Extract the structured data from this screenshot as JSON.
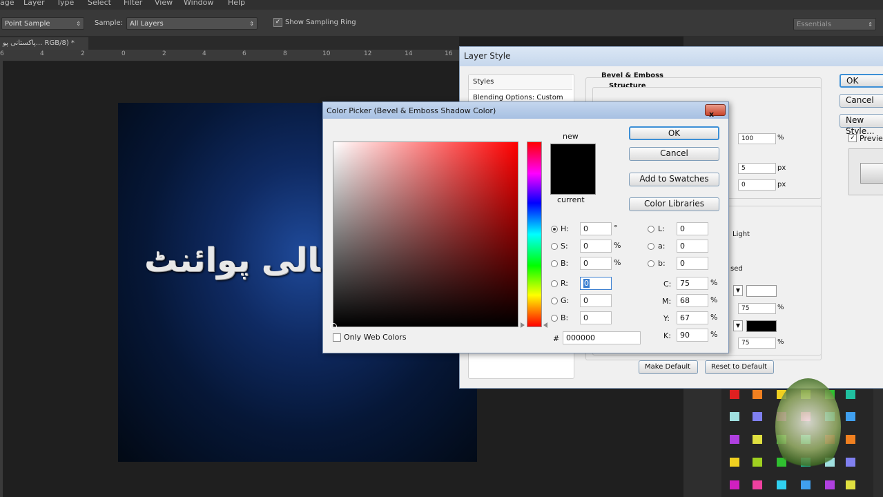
{
  "menubar": {
    "items": [
      "age",
      "Layer",
      "Type",
      "Select",
      "Filter",
      "View",
      "Window",
      "Help"
    ]
  },
  "options": {
    "sample_size": "Point Sample",
    "sample_label": "Sample:",
    "sample_value": "All Layers",
    "show_ring": "Show Sampling Ring",
    "workspace": "Essentials"
  },
  "document": {
    "tab_title": "پاکستانی پو... RGB/8) *",
    "ruler_ticks": [
      "6",
      "4",
      "2",
      "0",
      "2",
      "4",
      "6",
      "8",
      "10",
      "12",
      "14",
      "16"
    ],
    "canvas_text": "ﺎلی پوائنٹ"
  },
  "layer_style": {
    "title": "Layer Style",
    "styles_label": "Styles",
    "blending_label": "Blending Options: Custom",
    "section_title": "Bevel & Emboss",
    "subsection_title": "Structure",
    "ok": "OK",
    "cancel": "Cancel",
    "new_style": "New Style...",
    "preview": "Preview",
    "depth_value": "100",
    "depth_unit": "%",
    "size_value": "5",
    "size_unit": "px",
    "soften_value": "0",
    "soften_unit": "px",
    "light_label": "Light",
    "sed_label": "sed",
    "highlight_opacity": "75",
    "highlight_unit": "%",
    "shadow_opacity": "75",
    "shadow_unit": "%",
    "make_default": "Make Default",
    "reset_default": "Reset to Default"
  },
  "color_picker": {
    "title": "Color Picker (Bevel & Emboss Shadow Color)",
    "close": "x",
    "new_label": "new",
    "current_label": "current",
    "ok": "OK",
    "cancel": "Cancel",
    "add_swatches": "Add to Swatches",
    "color_libraries": "Color Libraries",
    "only_web": "Only Web Colors",
    "hsb": [
      {
        "label": "H:",
        "value": "0",
        "unit": "°",
        "selected": true
      },
      {
        "label": "S:",
        "value": "0",
        "unit": "%",
        "selected": false
      },
      {
        "label": "B:",
        "value": "0",
        "unit": "%",
        "selected": false
      }
    ],
    "rgb": [
      {
        "label": "R:",
        "value": "0"
      },
      {
        "label": "G:",
        "value": "0"
      },
      {
        "label": "B:",
        "value": "0"
      }
    ],
    "lab": [
      {
        "label": "L:",
        "value": "0"
      },
      {
        "label": "a:",
        "value": "0"
      },
      {
        "label": "b:",
        "value": "0"
      }
    ],
    "cmyk": [
      {
        "label": "C:",
        "value": "75",
        "unit": "%"
      },
      {
        "label": "M:",
        "value": "68",
        "unit": "%"
      },
      {
        "label": "Y:",
        "value": "67",
        "unit": "%"
      },
      {
        "label": "K:",
        "value": "90",
        "unit": "%"
      }
    ],
    "hex_label": "#",
    "hex_value": "000000",
    "new_color": "#000000"
  },
  "swatch_colors": [
    "#e02020",
    "#f08020",
    "#f0d020",
    "#a0d020",
    "#30c030",
    "#20c0a0",
    "#a0e0e0",
    "#8080f0",
    "#d020c0",
    "#f040a0",
    "#30d0f0",
    "#40a0f0",
    "#b040e0",
    "#e0e040",
    "#50e050",
    "#40f0c0"
  ]
}
